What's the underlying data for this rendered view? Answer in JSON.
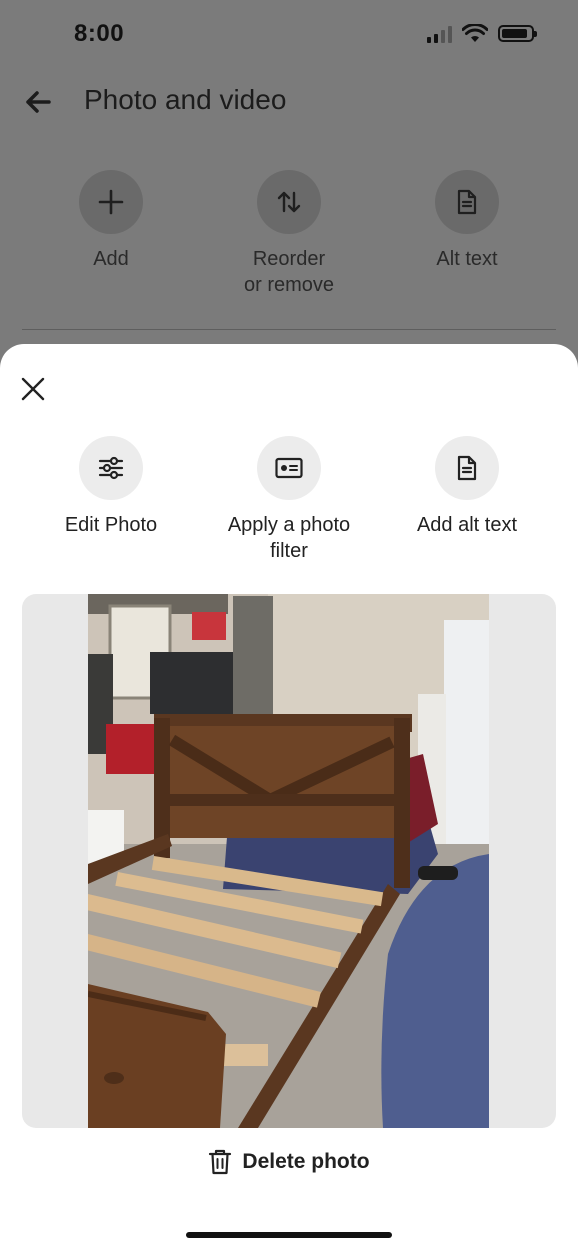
{
  "status": {
    "time": "8:00"
  },
  "header": {
    "title": "Photo and video"
  },
  "top_actions": [
    {
      "label": "Add",
      "icon": "plus-icon"
    },
    {
      "label": "Reorder\nor remove",
      "icon": "reorder-icon"
    },
    {
      "label": "Alt text",
      "icon": "document-icon"
    }
  ],
  "sheet": {
    "actions": [
      {
        "label": "Edit Photo",
        "icon": "sliders-icon"
      },
      {
        "label": "Apply a photo filter",
        "icon": "filter-icon"
      },
      {
        "label": "Add alt text",
        "icon": "document-icon"
      }
    ],
    "photo": {
      "subject": "wooden-bed-frame-photo"
    },
    "delete_label": "Delete photo"
  },
  "colors": {
    "overlay": "#7b7b7b",
    "sheet": "#ffffff",
    "button_bg": "#ececec",
    "photo_bg": "#e8e8e8"
  }
}
